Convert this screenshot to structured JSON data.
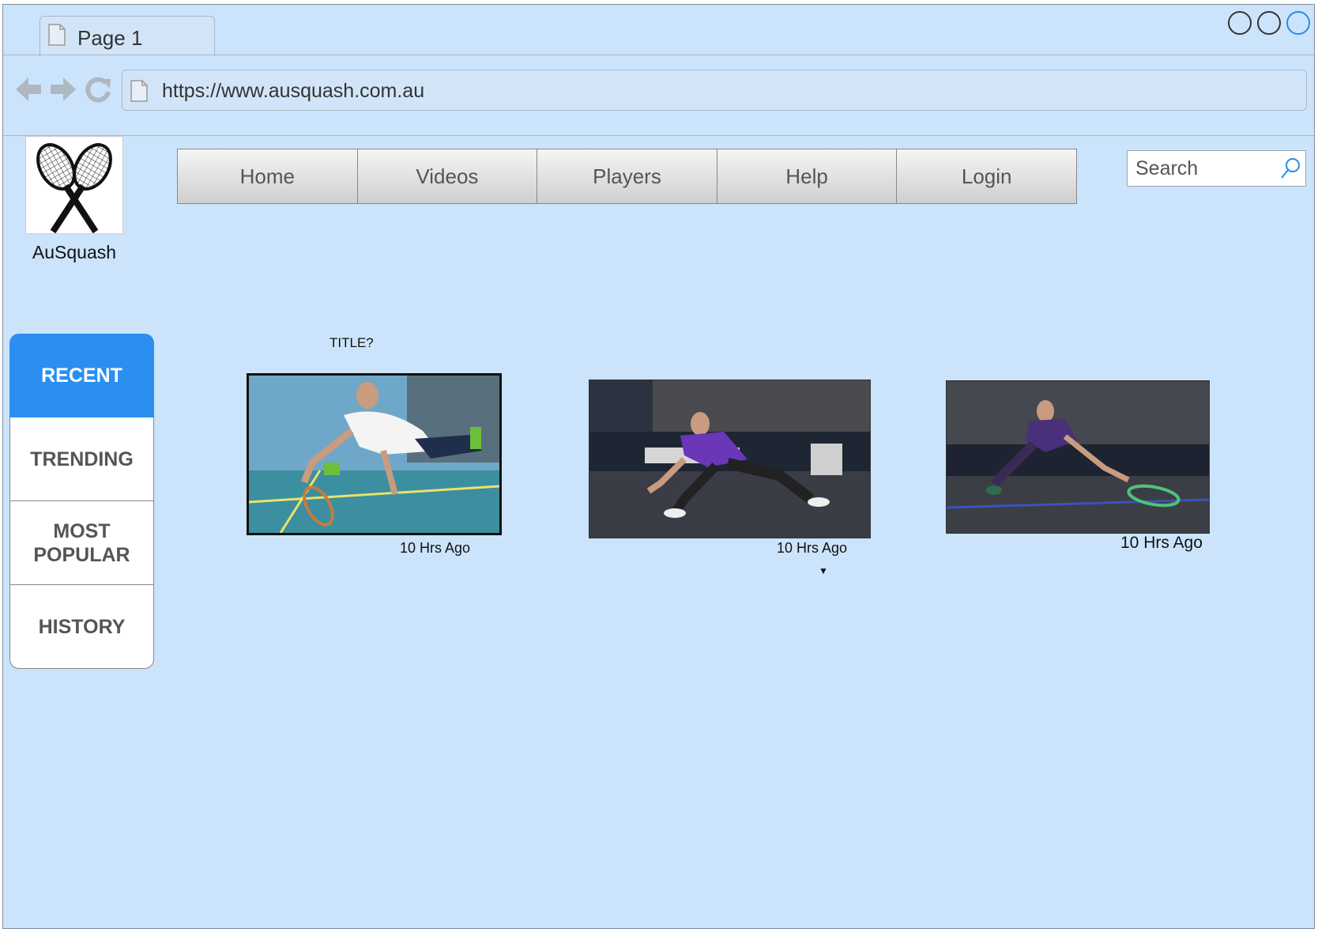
{
  "browser": {
    "tab_label": "Page 1",
    "url": "https://www.ausquash.com.au"
  },
  "logo": {
    "name": "AuSquash",
    "icon": "crossed-rackets-icon"
  },
  "menu": [
    "Home",
    "Videos",
    "Players",
    "Help",
    "Login"
  ],
  "search": {
    "placeholder": "Search"
  },
  "side_tabs": [
    "RECENT",
    "TRENDING",
    "MOST POPULAR",
    "HISTORY"
  ],
  "content": {
    "title": "TITLE?",
    "videos": [
      {
        "time": "10 Hrs Ago"
      },
      {
        "time": "10 Hrs Ago"
      },
      {
        "time": "10 Hrs Ago"
      }
    ]
  },
  "colors": {
    "background": "#cce4fb",
    "active_tab": "#2a8ff0"
  }
}
